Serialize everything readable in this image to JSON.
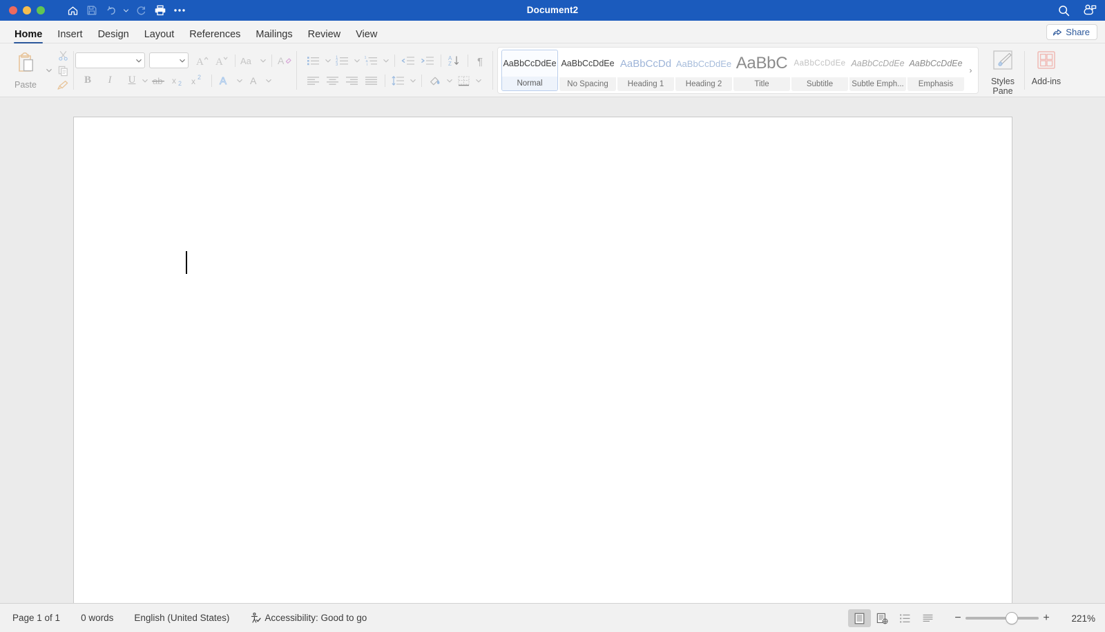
{
  "window": {
    "title": "Document2",
    "traffic_lights": [
      "close-red",
      "minimize-yellow",
      "maximize-green"
    ],
    "colors": {
      "titlebar": "#1b5bbd",
      "accent": "#2b579a",
      "ribbon_bg": "#f3f3f3"
    }
  },
  "quick_access": {
    "items": [
      {
        "name": "home",
        "label": "Home"
      },
      {
        "name": "save",
        "label": "Save"
      },
      {
        "name": "undo",
        "label": "Undo"
      },
      {
        "name": "undo-dropdown",
        "label": "Undo options"
      },
      {
        "name": "redo",
        "label": "Redo"
      },
      {
        "name": "print",
        "label": "Print"
      },
      {
        "name": "more",
        "label": "More"
      }
    ]
  },
  "title_right": {
    "search_label": "Search",
    "copilot_label": "Copilot"
  },
  "tabs": [
    {
      "label": "Home",
      "active": true
    },
    {
      "label": "Insert",
      "active": false
    },
    {
      "label": "Design",
      "active": false
    },
    {
      "label": "Layout",
      "active": false
    },
    {
      "label": "References",
      "active": false
    },
    {
      "label": "Mailings",
      "active": false
    },
    {
      "label": "Review",
      "active": false
    },
    {
      "label": "View",
      "active": false
    }
  ],
  "share": {
    "label": "Share"
  },
  "ribbon": {
    "clipboard": {
      "paste_label": "Paste",
      "cut_label": "Cut",
      "copy_label": "Copy",
      "format_painter_label": "Format Painter"
    },
    "font": {
      "font_name_value": "",
      "font_name_placeholder": "",
      "font_size_value": "",
      "font_size_placeholder": "",
      "grow_font_label": "Grow Font",
      "shrink_font_label": "Shrink Font",
      "change_case_label": "Change Case",
      "clear_formatting_label": "Clear All Formatting",
      "bold_label": "B",
      "italic_label": "I",
      "underline_label": "U",
      "strikethrough_label": "Strikethrough",
      "subscript_label": "Subscript",
      "superscript_label": "Superscript",
      "text_effects_label": "Text Effects",
      "font_color_label": "Font Color"
    },
    "paragraph": {
      "bullets_label": "Bullets",
      "numbering_label": "Numbering",
      "multilevel_label": "Multilevel List",
      "decrease_indent_label": "Decrease Indent",
      "increase_indent_label": "Increase Indent",
      "sort_label": "Sort",
      "show_marks_label": "Show/Hide Paragraph Marks",
      "align_left_label": "Align Left",
      "align_center_label": "Center",
      "align_right_label": "Align Right",
      "justify_label": "Justify",
      "line_spacing_label": "Line and Paragraph Spacing",
      "shading_label": "Shading",
      "borders_label": "Borders"
    },
    "styles": {
      "gallery": [
        {
          "preview": "AaBbCcDdEe",
          "name": "Normal",
          "selected": true,
          "preview_style": "normal"
        },
        {
          "preview": "AaBbCcDdEe",
          "name": "No Spacing",
          "selected": false,
          "preview_style": "normal"
        },
        {
          "preview": "AaBbCcDd",
          "name": "Heading 1",
          "selected": false,
          "preview_style": "heading1"
        },
        {
          "preview": "AaBbCcDdEe",
          "name": "Heading 2",
          "selected": false,
          "preview_style": "heading2"
        },
        {
          "preview": "AaBbC",
          "name": "Title",
          "selected": false,
          "preview_style": "title"
        },
        {
          "preview": "AaBbCcDdEe",
          "name": "Subtitle",
          "selected": false,
          "preview_style": "subtitle"
        },
        {
          "preview": "AaBbCcDdEe",
          "name": "Subtle Emph...",
          "selected": false,
          "preview_style": "subtle-emphasis"
        },
        {
          "preview": "AaBbCcDdEe",
          "name": "Emphasis",
          "selected": false,
          "preview_style": "emphasis"
        }
      ],
      "more_label": "›",
      "styles_pane_label": "Styles\nPane",
      "styles_pane_line1": "Styles",
      "styles_pane_line2": "Pane"
    },
    "addins": {
      "label": "Add-ins"
    }
  },
  "document": {
    "page_count_text": "Page 1 of 1",
    "body_text": "",
    "cursor_visible": true
  },
  "status_bar": {
    "page": "Page 1 of 1",
    "words": "0 words",
    "language": "English (United States)",
    "accessibility": "Accessibility: Good to go",
    "views": [
      {
        "name": "print-layout",
        "label": "Print Layout",
        "active": true
      },
      {
        "name": "web-layout",
        "label": "Web Layout",
        "active": false
      },
      {
        "name": "outline",
        "label": "Outline",
        "active": false
      },
      {
        "name": "draft",
        "label": "Draft",
        "active": false
      }
    ],
    "zoom_out_label": "−",
    "zoom_in_label": "+",
    "zoom_percent": "221%"
  }
}
